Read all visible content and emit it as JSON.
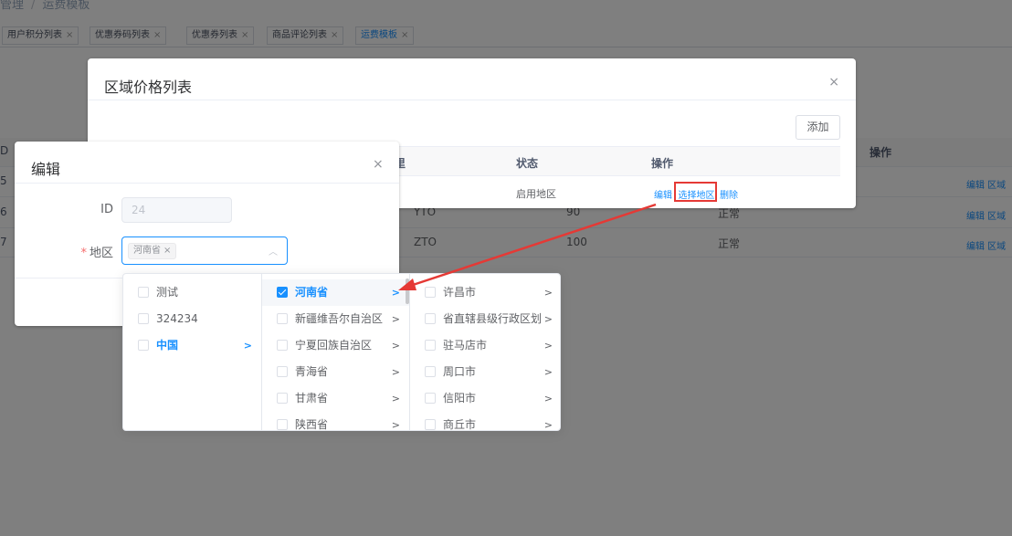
{
  "breadcrumb": {
    "parent": "管理",
    "sep": "/",
    "current": "运费模板"
  },
  "tags": [
    {
      "label": "用户积分列表"
    },
    {
      "label": "优惠券码列表"
    },
    {
      "label": "优惠券列表"
    },
    {
      "label": "商品评论列表"
    },
    {
      "label": "运费模板",
      "active": true
    }
  ],
  "tag_close": "×",
  "bg_table": {
    "header_id": "D",
    "header_ops": "操作",
    "rows": [
      {
        "id": "5",
        "ops": "编辑 区域"
      },
      {
        "id": "6",
        "code": "YTO",
        "price": "90",
        "status": "正常",
        "ops": "编辑 区域"
      },
      {
        "id": "7",
        "code": "ZTO",
        "price": "100",
        "status": "正常",
        "ops": "编辑 区域"
      }
    ]
  },
  "region_dialog": {
    "title": "区域价格列表",
    "close": "×",
    "add_label": "添加",
    "columns": {
      "c1": "里",
      "status": "状态",
      "ops": "操作"
    },
    "row": {
      "c1": "i",
      "status": "启用地区",
      "op_edit": "编辑",
      "op_select": "选择地区",
      "op_delete": "删除"
    }
  },
  "edit_dialog": {
    "title": "编辑",
    "close": "×",
    "id_label": "ID",
    "id_value": "24",
    "region_label": "地区",
    "region_required": "*",
    "selected_tag": "河南省",
    "tag_close": "×",
    "dropdown_arrow": "︿"
  },
  "cascader": {
    "col1": [
      {
        "label": "测试",
        "checked": false
      },
      {
        "label": "324234",
        "checked": false
      },
      {
        "label": "中国",
        "checked": false,
        "active": true,
        "has_children": true
      }
    ],
    "col2": [
      {
        "label": "河南省",
        "checked": true,
        "active": true
      },
      {
        "label": "新疆维吾尔自治区",
        "checked": false
      },
      {
        "label": "宁夏回族自治区",
        "checked": false
      },
      {
        "label": "青海省",
        "checked": false
      },
      {
        "label": "甘肃省",
        "checked": false
      },
      {
        "label": "陕西省",
        "checked": false
      }
    ],
    "col3": [
      {
        "label": "许昌市",
        "checked": false
      },
      {
        "label": "省直辖县级行政区划",
        "checked": false
      },
      {
        "label": "驻马店市",
        "checked": false
      },
      {
        "label": "周口市",
        "checked": false
      },
      {
        "label": "信阳市",
        "checked": false
      },
      {
        "label": "商丘市",
        "checked": false
      }
    ],
    "arrow": ">"
  },
  "colors": {
    "primary": "#1890ff",
    "annotation": "#e53935",
    "mask": "rgba(0,0,0,0.5)"
  }
}
